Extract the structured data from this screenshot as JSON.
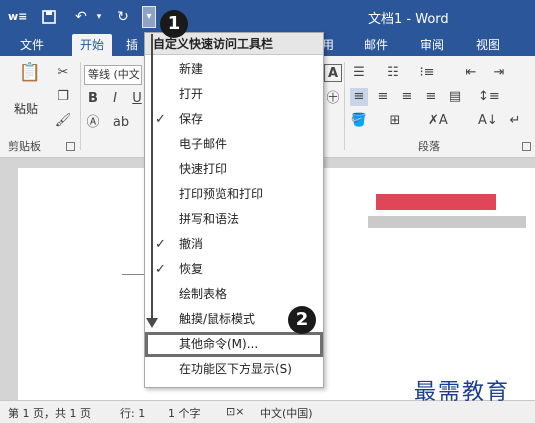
{
  "titlebar": {
    "doc_title": "文档1 - Word",
    "qat_icons": [
      "word-logo-icon",
      "save-icon",
      "undo-icon",
      "repeat-icon",
      "customize-qat-icon"
    ]
  },
  "tabs": [
    {
      "label": "文件"
    },
    {
      "label": "开始"
    },
    {
      "label": "插"
    },
    {
      "label": "用"
    },
    {
      "label": "邮件"
    },
    {
      "label": "审阅"
    },
    {
      "label": "视图"
    }
  ],
  "ribbon": {
    "paste_label": "粘贴",
    "font_name": "等线 (中文",
    "clipboard_group": "剪贴板",
    "paragraph_group": "段落",
    "bold": "B",
    "italic": "I",
    "underline": "U"
  },
  "menu": {
    "header": "自定义快速访问工具栏",
    "items": [
      {
        "label": "新建",
        "checked": false
      },
      {
        "label": "打开",
        "checked": false
      },
      {
        "label": "保存",
        "checked": true
      },
      {
        "label": "电子邮件",
        "checked": false
      },
      {
        "label": "快速打印",
        "checked": false
      },
      {
        "label": "打印预览和打印",
        "checked": false
      },
      {
        "label": "拼写和语法",
        "checked": false
      },
      {
        "label": "撤消",
        "checked": true
      },
      {
        "label": "恢复",
        "checked": true
      },
      {
        "label": "绘制表格",
        "checked": false
      },
      {
        "label": "触摸/鼠标模式",
        "checked": false
      },
      {
        "label": "其他命令(M)...",
        "checked": false
      },
      {
        "label": "在功能区下方显示(S)",
        "checked": false
      }
    ],
    "check_glyph": "✓"
  },
  "callouts": [
    "1",
    "2"
  ],
  "statusbar": {
    "page": "第 1 页，共 1 页",
    "row": "行: 1",
    "chars": "1 个字",
    "language": "中文(中国)"
  },
  "watermark": "最需教育",
  "colors": {
    "accent": "#2b579a",
    "menu_highlight_border": "#6e6e6e"
  }
}
